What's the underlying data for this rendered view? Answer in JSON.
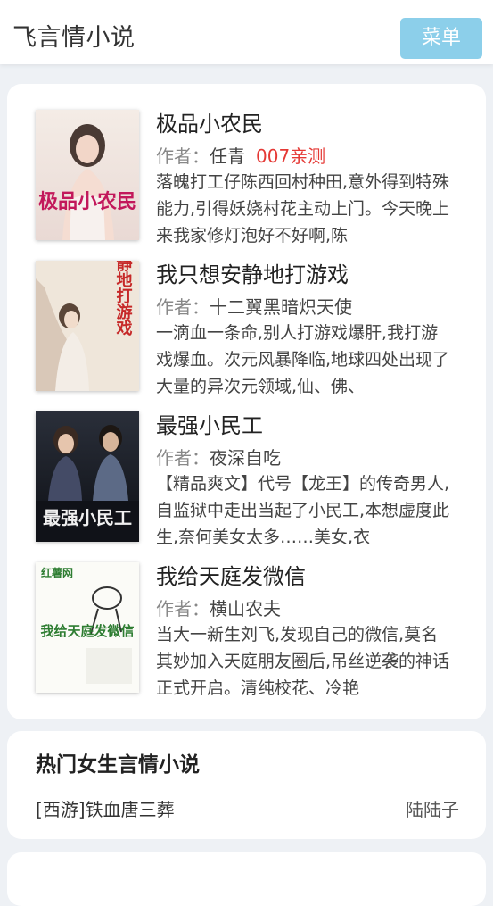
{
  "header": {
    "title": "飞言情小说",
    "menu_label": "菜单"
  },
  "author_prefix": "作者：",
  "books": [
    {
      "title": "极品小农民",
      "author": "任青",
      "tag": "007亲测",
      "description": "落魄打工仔陈西回村种田,意外得到特殊能力,引得妖娆村花主动上门。今天晚上来我家修灯泡好不好啊,陈",
      "cover_text": "极品小农民"
    },
    {
      "title": "我只想安静地打游戏",
      "author": "十二翼黑暗炽天使",
      "tag": "",
      "description": "一滴血一条命,别人打游戏爆肝,我打游戏爆血。次元风暴降临,地球四处出现了大量的异次元领域,仙、佛、",
      "cover_text": "安静地打游戏"
    },
    {
      "title": "最强小民工",
      "author": "夜深自吃",
      "tag": "",
      "description": "【精品爽文】代号【龙王】的传奇男人,自监狱中走出当起了小民工,本想虚度此生,奈何美女太多……美女,衣",
      "cover_text": "最强小民工"
    },
    {
      "title": "我给天庭发微信",
      "author": "横山农夫",
      "tag": "",
      "description": "当大一新生刘飞,发现自己的微信,莫名其妙加入天庭朋友圈后,吊丝逆袭的神话正式开启。清纯校花、冷艳",
      "cover_text": "我给天庭发微信",
      "cover_brand": "红薯网"
    }
  ],
  "hot": {
    "title": "热门女生言情小说",
    "items": [
      {
        "title": "[西游]铁血唐三葬",
        "author": "陆陆子"
      }
    ]
  }
}
